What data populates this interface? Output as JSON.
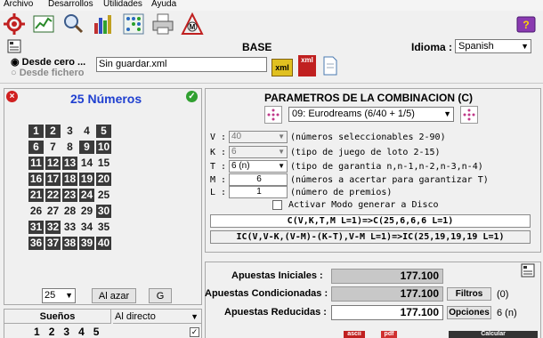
{
  "menu": [
    "Archivo",
    "Desarrollos",
    "Utilidades",
    "Ayuda"
  ],
  "toolbar_icons": [
    "settings-icon",
    "chart-icon",
    "search-icon",
    "bar-chart-icon",
    "matrix-icon",
    "printer-icon",
    "logo-icon",
    "help-book-icon"
  ],
  "base": {
    "header_icon": "document-icon",
    "title": "BASE",
    "idioma_label": "Idioma :",
    "idioma_value": "Spanish",
    "radio_new": "Desde cero ...",
    "radio_file": "Desde fichero",
    "file_value": "Sin guardar.xml",
    "xml_icon_label": "xml",
    "xml_icon2_label": "xml"
  },
  "numbers_panel": {
    "title": "25 Números",
    "numbers": [
      1,
      2,
      3,
      4,
      5,
      6,
      7,
      8,
      9,
      10,
      11,
      12,
      13,
      14,
      15,
      16,
      17,
      18,
      19,
      20,
      21,
      22,
      23,
      24,
      25,
      26,
      27,
      28,
      29,
      30,
      31,
      32,
      33,
      34,
      35,
      36,
      37,
      38,
      39,
      40
    ],
    "selected": [
      1,
      2,
      5,
      6,
      9,
      10,
      11,
      12,
      13,
      16,
      17,
      18,
      19,
      20,
      21,
      22,
      23,
      24,
      30,
      31,
      32,
      36,
      37,
      38,
      39,
      40
    ],
    "count_select": "25",
    "random_button": "Al azar",
    "g_button": "G"
  },
  "dreams": {
    "label": "Sueños",
    "mode": "Al directo",
    "numbers": [
      "1",
      "2",
      "3",
      "4",
      "5"
    ]
  },
  "params": {
    "title": "PARAMETROS DE LA COMBINACION (C)",
    "game": "09: Eurodreams (6/40 + 1/5)",
    "rows": [
      {
        "key": "V :",
        "value": "40",
        "desc": "(números seleccionables 2-90)",
        "kind": "combo-disabled"
      },
      {
        "key": "K :",
        "value": "6",
        "desc": "(tipo de juego de loto 2-15)",
        "kind": "combo-disabled"
      },
      {
        "key": "T :",
        "value": "6 (n)",
        "desc": "(tipo de garantia n,n-1,n-2,n-3,n-4)",
        "kind": "combo"
      },
      {
        "key": "M :",
        "value": "6",
        "desc": "(números a acertar para garantizar T)",
        "kind": "field"
      },
      {
        "key": "L :",
        "value": "1",
        "desc": "(número de premios)",
        "kind": "field"
      }
    ],
    "disk_checkbox": "Activar Modo generar a Disco",
    "formula1": "C(V,K,T,M L=1)=>C(25,6,6,6 L=1)",
    "formula2": "IC(V,V-K,(V-M)-(K-T),V-M L=1)=>IC(25,19,19,19 L=1)"
  },
  "results": {
    "rows": [
      {
        "label": "Apuestas Iniciales :",
        "value": "177.100"
      },
      {
        "label": "Apuestas Condicionadas :",
        "value": "177.100",
        "button": "Filtros",
        "extra": "(0)"
      },
      {
        "label": "Apuestas Reducidas :",
        "value": "177.100",
        "button": "Opciones",
        "extra": "6 (n)"
      }
    ],
    "bottom_icon1": "ascii",
    "bottom_icon2": "pdf",
    "bottom_button": "Calcular"
  }
}
